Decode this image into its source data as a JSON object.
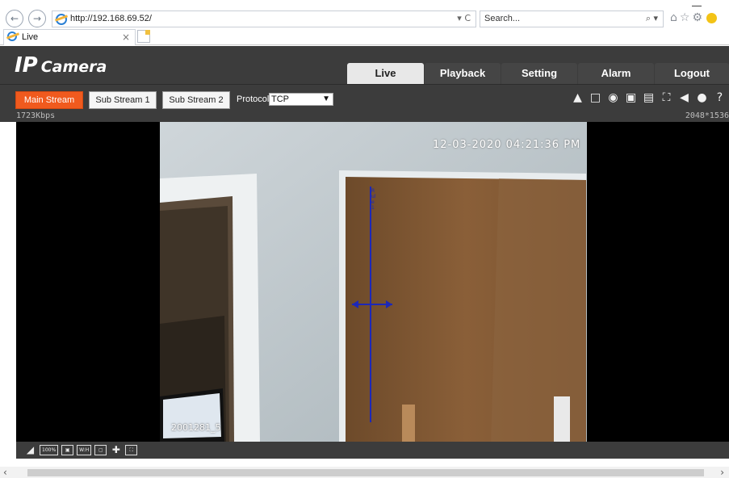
{
  "browser": {
    "url": "http://192.168.69.52/",
    "url_tools": "▾ C",
    "search_placeholder": "Search...",
    "search_tools": "⌕ ▾",
    "tab_title": "Live",
    "tab_close": "×"
  },
  "app": {
    "brand_prefix": "IP",
    "brand_name": "Camera",
    "nav_tabs": [
      "Live",
      "Playback",
      "Setting",
      "Alarm",
      "Logout"
    ],
    "active_tab": "Live"
  },
  "stream": {
    "buttons": [
      "Main Stream",
      "Sub Stream 1",
      "Sub Stream 2"
    ],
    "active": "Main Stream",
    "protocol_label": "Protocol",
    "protocol_value": "TCP"
  },
  "video": {
    "bitrate": "1723Kbps",
    "resolution": "2048*1536",
    "osd_time": "12-03-2020 04:21:36 PM",
    "osd_sub": "2001281_5",
    "rule_label": "Rule1"
  },
  "bottom_tools": {
    "ratio": "100%",
    "width_height": "W:H"
  },
  "colors": {
    "accent": "#f05a1e",
    "header_bg": "#3c3c3c",
    "rule_line": "#1c28b8"
  }
}
